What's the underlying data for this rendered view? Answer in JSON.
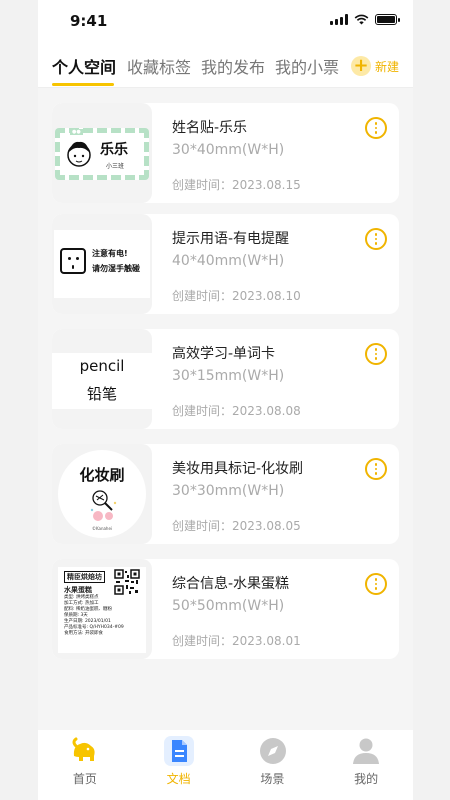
{
  "status_bar": {
    "time": "9:41"
  },
  "tabs": [
    {
      "label": "个人空间",
      "active": true
    },
    {
      "label": "收藏标签",
      "active": false
    },
    {
      "label": "我的发布",
      "active": false
    },
    {
      "label": "我的小票",
      "active": false
    }
  ],
  "new_button": {
    "icon": "plus-icon",
    "label": "新建"
  },
  "colors": {
    "accent": "#f0b400",
    "active_underline": "#f7c400",
    "doc_blue": "#3a86ff"
  },
  "cards": [
    {
      "title": "姓名贴-乐乐",
      "size": "30*40mm(W*H)",
      "date": "创建时间：2023.08.15",
      "thumb": {
        "name": "乐乐",
        "sub": "小三班"
      }
    },
    {
      "title": "提示用语-有电提醒",
      "size": "40*40mm(W*H)",
      "date": "创建时间：2023.08.10",
      "thumb": {
        "line1": "注意有电!",
        "line2": "请勿湿手触碰"
      }
    },
    {
      "title": "高效学习-单词卡",
      "size": "30*15mm(W*H)",
      "date": "创建时间：2023.08.08",
      "thumb": {
        "en": "pencil",
        "cn": "铅笔"
      }
    },
    {
      "title": "美妆用具标记-化妆刷",
      "size": "30*30mm(W*H)",
      "date": "创建时间：2023.08.05",
      "thumb": {
        "title": "化妆刷",
        "brand": "©Kanahei"
      }
    },
    {
      "title": "综合信息-水果蛋糕",
      "size": "50*50mm(W*H)",
      "date": "创建时间：2023.08.01",
      "thumb": {
        "head": "精臣烘焙坊",
        "name": "水果蛋糕",
        "lines": [
          "类型: 烘烤类糕点",
          "加工方式: 热加工",
          "配料: 稀奶油蛋糕、糖粉",
          "保质期: 3天",
          "生产日期: 2023/01/01",
          "产品标准号: Q/HYH034-#09",
          "食用方法: 开袋即食"
        ]
      }
    }
  ],
  "bottom_nav": [
    {
      "label": "首页",
      "icon": "elephant-home-icon",
      "active": false
    },
    {
      "label": "文档",
      "icon": "document-icon",
      "active": true
    },
    {
      "label": "场景",
      "icon": "compass-icon",
      "active": false
    },
    {
      "label": "我的",
      "icon": "person-icon",
      "active": false
    }
  ]
}
